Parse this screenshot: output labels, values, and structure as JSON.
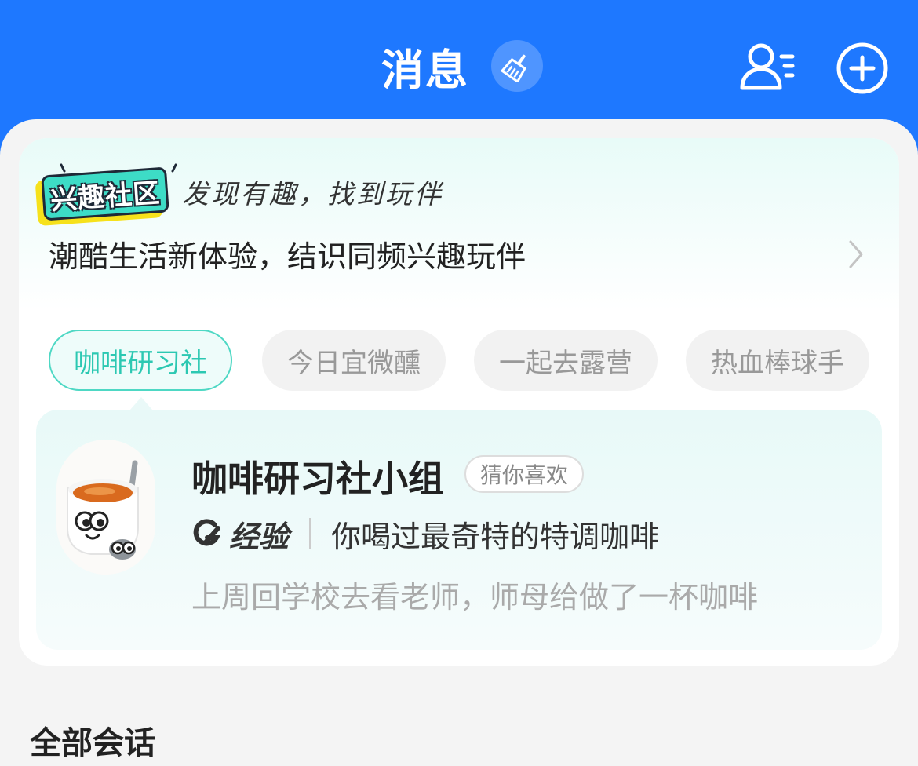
{
  "header": {
    "title": "消息",
    "icons": [
      "broom-icon",
      "contacts-icon",
      "add-circle-icon"
    ]
  },
  "community_card": {
    "logo_text": "兴趣社区",
    "slogan": "发现有趣，找到玩伴",
    "subtitle": "潮酷生活新体验，结识同频兴趣玩伴",
    "tabs": [
      {
        "label": "咖啡研习社",
        "active": true
      },
      {
        "label": "今日宜微醺",
        "active": false
      },
      {
        "label": "一起去露营",
        "active": false
      },
      {
        "label": "热血棒球手",
        "active": false
      }
    ],
    "group": {
      "name": "咖啡研习社小组",
      "badge": "猜你喜欢",
      "post_type": "经验",
      "topic": "你喝过最奇特的特调咖啡",
      "preview": "上周回学校去看老师，师母给做了一杯咖啡"
    }
  },
  "conversations": {
    "section_title": "全部会话"
  },
  "colors": {
    "header_bg": "#1e78ff",
    "accent_teal": "#2cc8b2",
    "page_bg": "#f4f4f4"
  }
}
